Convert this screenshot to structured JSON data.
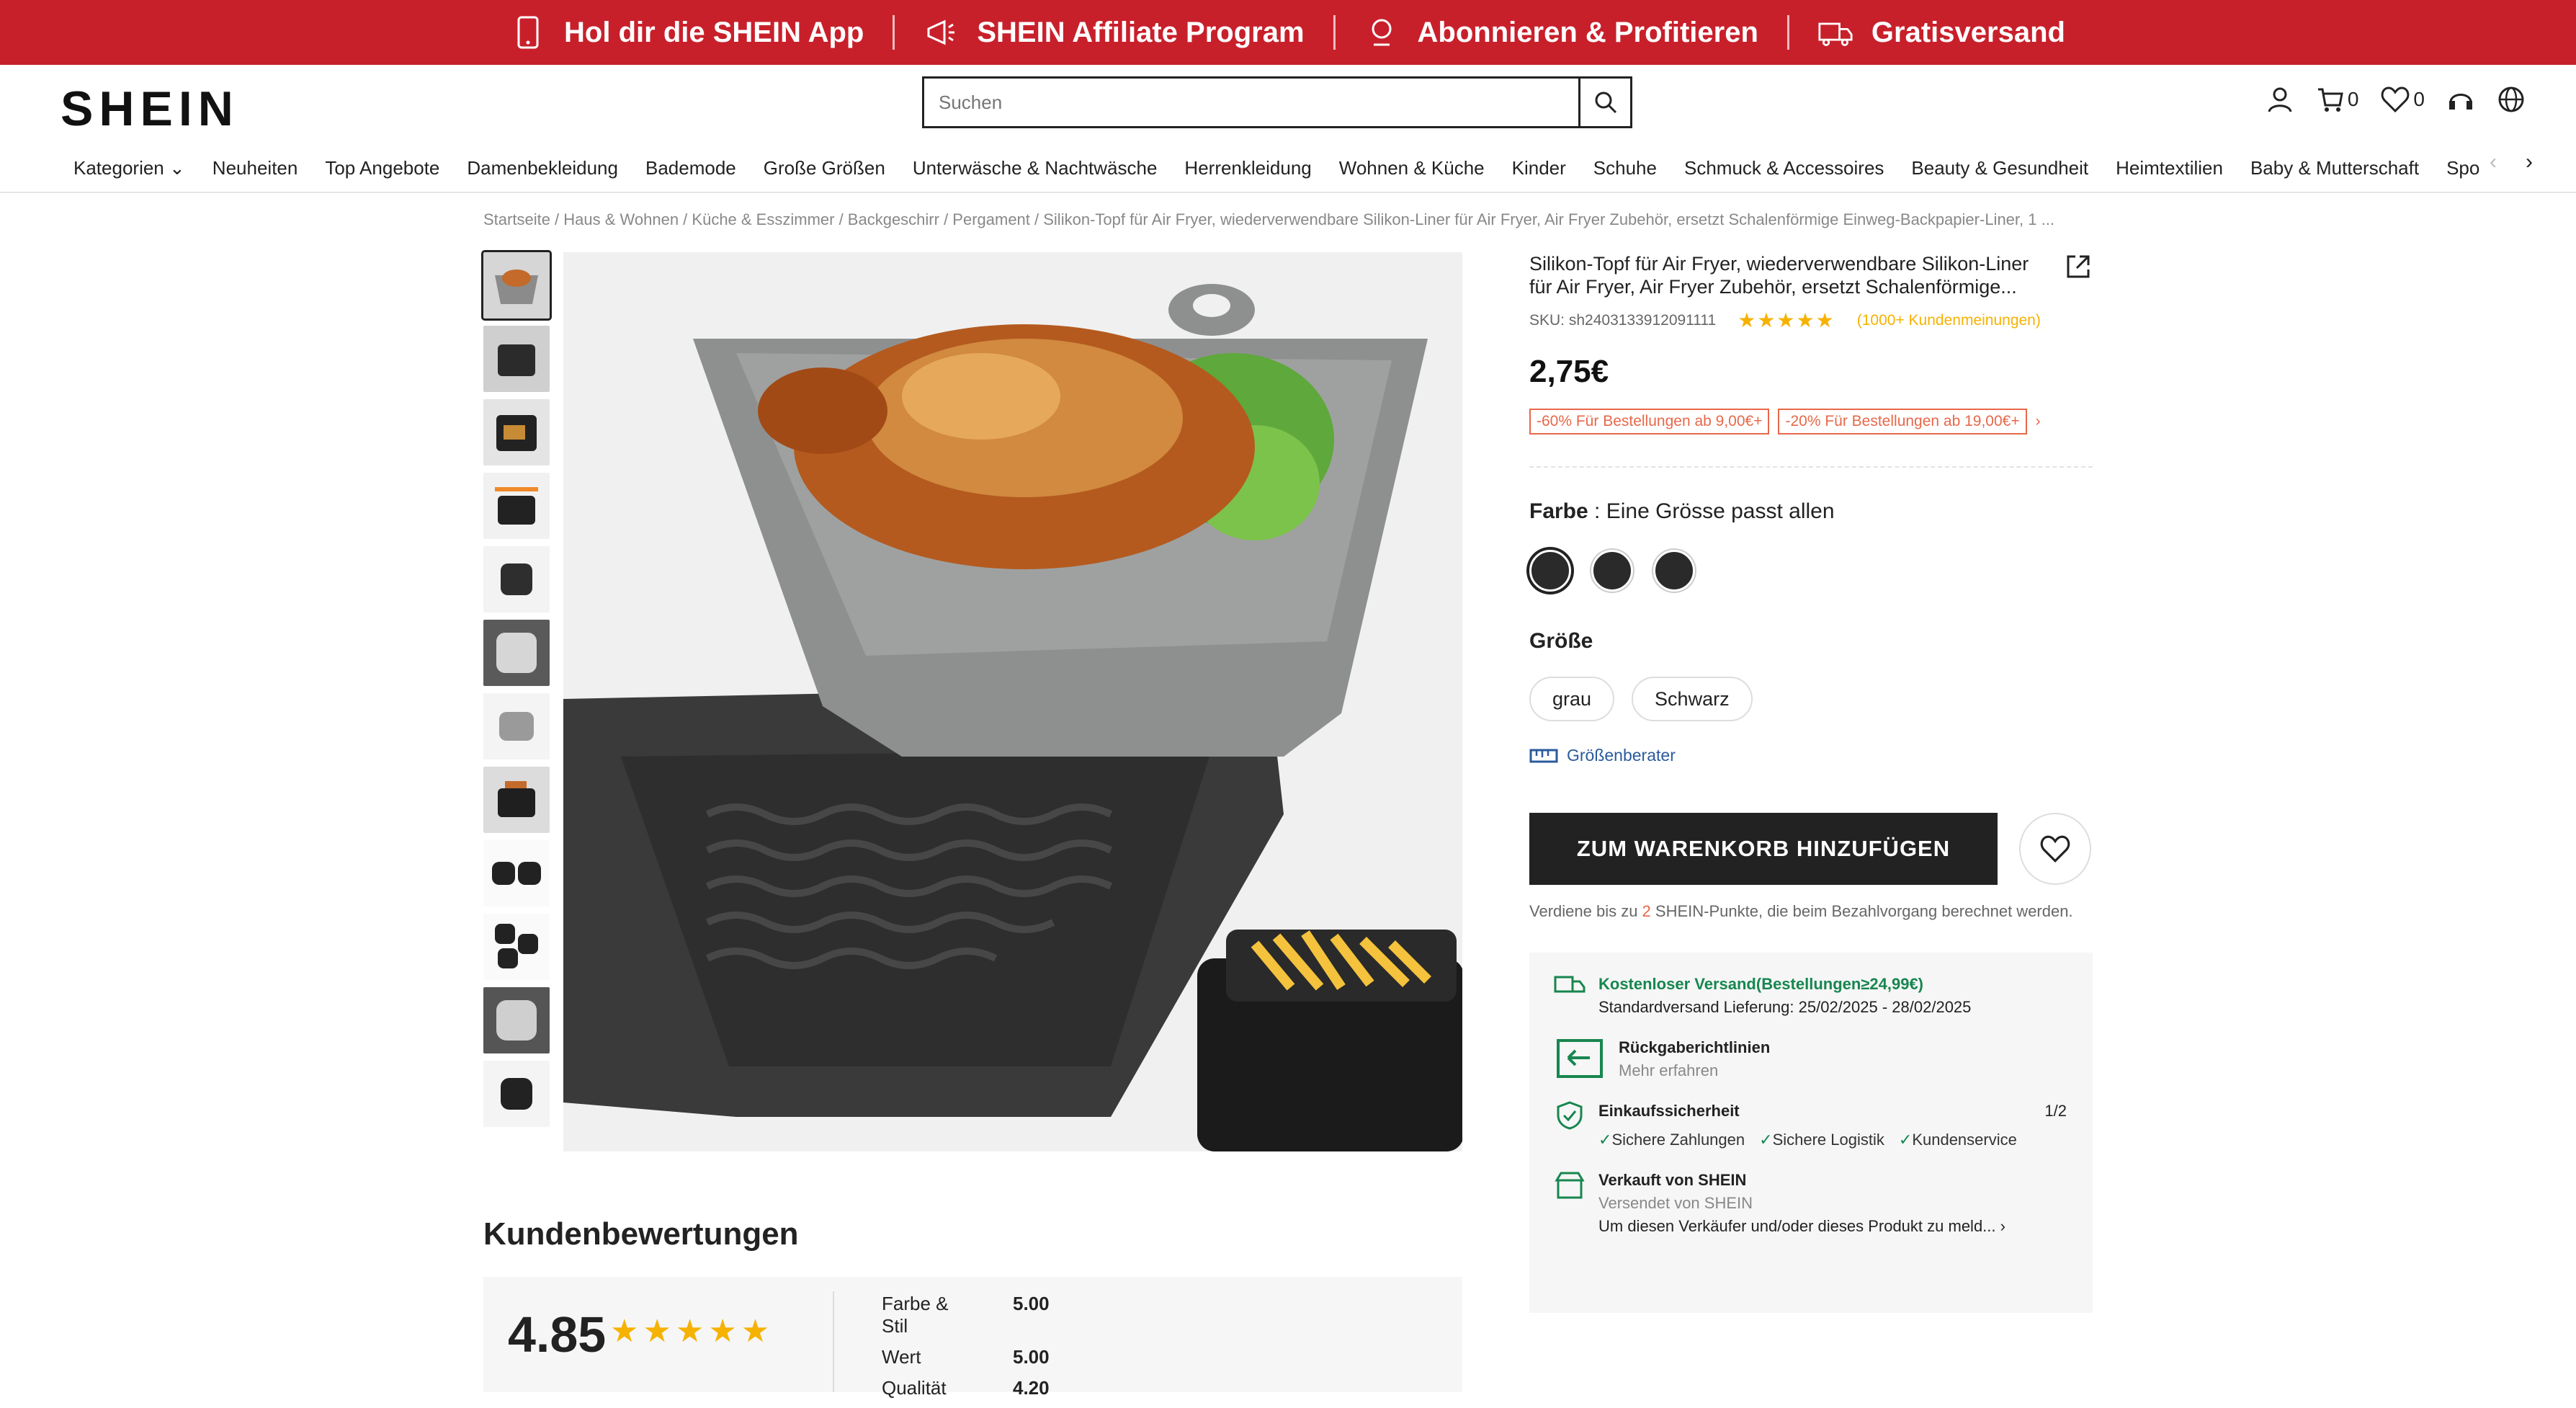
{
  "promo": {
    "items": [
      "Hol dir die SHEIN App",
      "SHEIN Affiliate Program",
      "Abonnieren & Profitieren",
      "Gratisversand"
    ]
  },
  "header": {
    "logo": "SHEIN",
    "search_placeholder": "Suchen",
    "cart_count": "0",
    "wishlist_count": "0"
  },
  "nav": {
    "items": [
      "Kategorien",
      "Neuheiten",
      "Top Angebote",
      "Damenbekleidung",
      "Bademode",
      "Große Größen",
      "Unterwäsche & Nachtwäsche",
      "Herrenkleidung",
      "Wohnen & Küche",
      "Kinder",
      "Schuhe",
      "Schmuck & Accessoires",
      "Beauty & Gesundheit",
      "Heimtextilien",
      "Baby & Mutterschaft",
      "Sport & Ou"
    ]
  },
  "breadcrumb": "Startseite / Haus & Wohnen / Küche & Esszimmer / Backgeschirr / Pergament / Silikon-Topf für Air Fryer, wiederverwendbare Silikon-Liner für Air Fryer, Air Fryer Zubehör, ersetzt Schalenförmige Einweg-Backpapier-Liner, 1 ...",
  "product": {
    "title": "Silikon-Topf für Air Fryer, wiederverwendbare Silikon-Liner für Air Fryer, Air Fryer Zubehör, ersetzt Schalenförmige...",
    "sku": "SKU: sh2403133912091111",
    "reviews_link": "(1000+ Kundenmeinungen)",
    "price": "2,75€",
    "promo_1": "-60% Für Bestellungen ab 9,00€+",
    "promo_2": "-20% Für Bestellungen ab 19,00€+",
    "color_label": "Farbe",
    "color_value": ": Eine Grösse passt allen",
    "size_label": "Größe",
    "sizes": [
      "grau",
      "Schwarz"
    ],
    "size_guide": "Größenberater",
    "cart_button": "ZUM WARENKORB HINZUFÜGEN",
    "points_pre": "Verdiene bis zu ",
    "points_num": "2",
    "points_post": " SHEIN-Punkte, die beim Bezahlvorgang berechnet werden."
  },
  "info": {
    "shipping_title": "Kostenloser Versand(Bestellungen≥24,99€)",
    "shipping_sub": "Standardversand Lieferung: 25/02/2025 - 28/02/2025",
    "returns_title": "Rückgaberichtlinien",
    "returns_sub": "Mehr erfahren",
    "security_title": "Einkaufssicherheit",
    "security_pager": "1/2",
    "checks": [
      "Sichere Zahlungen",
      "Sichere Logistik",
      "Kundenservice"
    ],
    "seller_title": "Verkauft von SHEIN",
    "seller_sub": "Versendet von SHEIN",
    "seller_report": "Um diesen Verkäufer und/oder dieses Produkt zu meld..."
  },
  "reviews": {
    "title": "Kundenbewertungen",
    "overall": "4.85",
    "metrics": [
      {
        "name": "Farbe & Stil",
        "value": "5.00"
      },
      {
        "name": "Wert",
        "value": "5.00"
      },
      {
        "name": "Qualität",
        "value": "4.20"
      }
    ]
  },
  "colors": {
    "brand_red": "#c8202b",
    "accent_orange": "#e8684a",
    "star": "#f6b200",
    "green": "#17864f"
  }
}
